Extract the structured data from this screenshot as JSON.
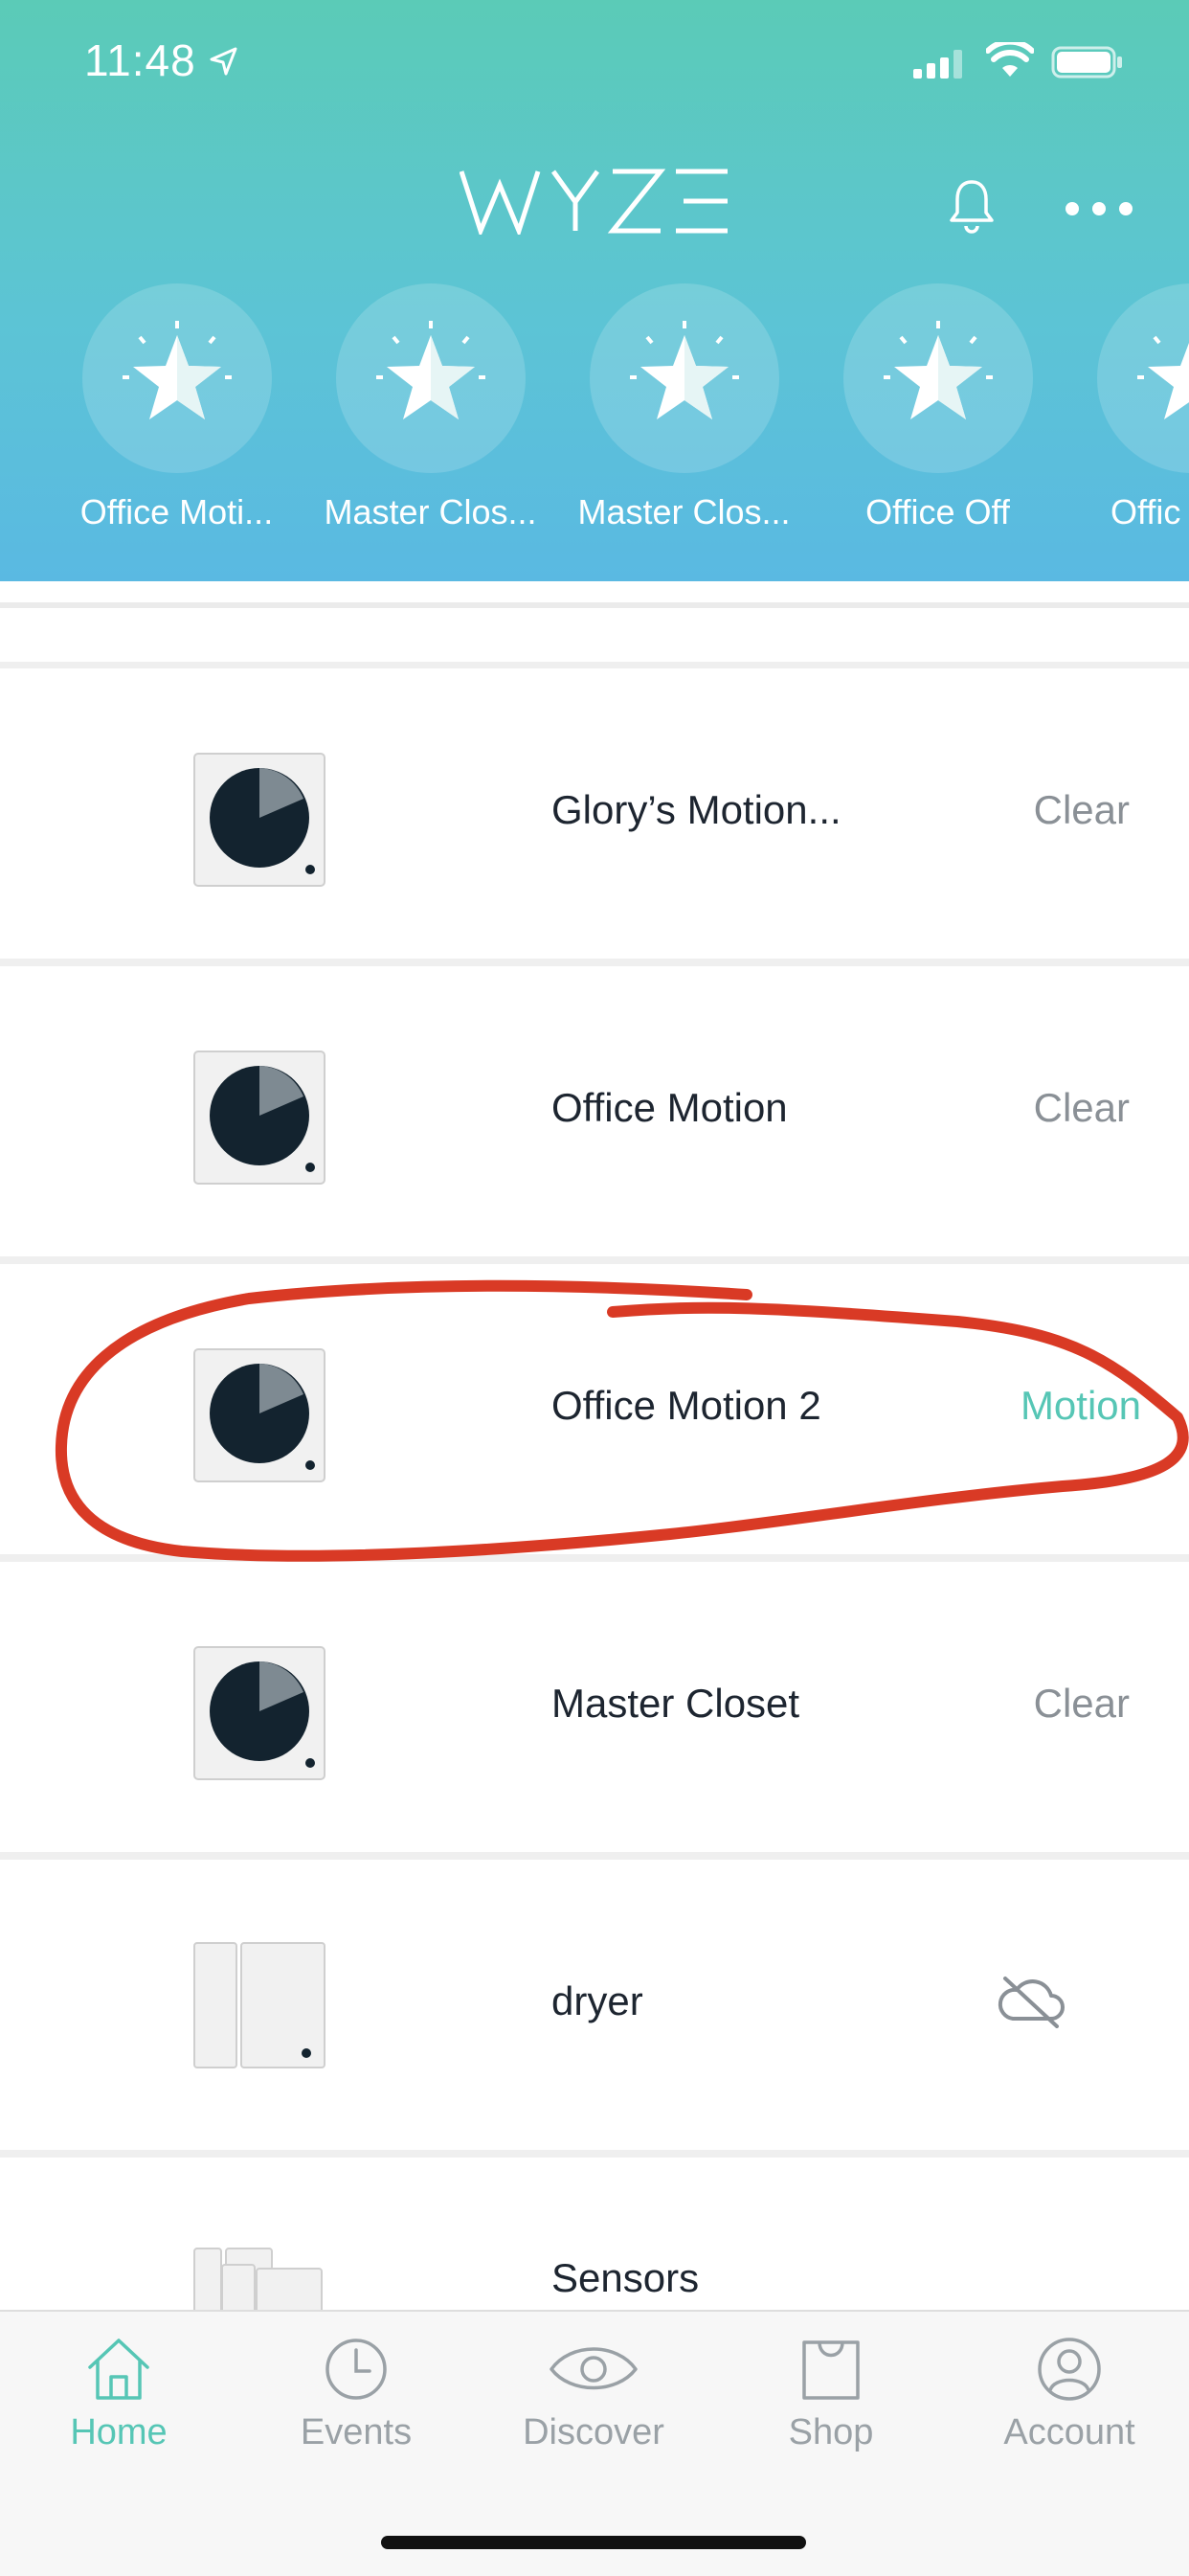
{
  "status_bar": {
    "time": "11:48"
  },
  "header": {
    "logo": "WYZE"
  },
  "favorites": [
    {
      "label": "Office Moti..."
    },
    {
      "label": "Master Clos..."
    },
    {
      "label": "Master Clos..."
    },
    {
      "label": "Office Off"
    },
    {
      "label": "Offic"
    }
  ],
  "devices": [
    {
      "name": "Glory’s Motion...",
      "status": "Clear",
      "icon": "motion-sensor-icon"
    },
    {
      "name": "Office Motion",
      "status": "Clear",
      "icon": "motion-sensor-icon"
    },
    {
      "name": "Office Motion 2",
      "status": "Motion",
      "icon": "motion-sensor-icon"
    },
    {
      "name": "Master Closet",
      "status": "Clear",
      "icon": "motion-sensor-icon"
    },
    {
      "name": "dryer",
      "status": "",
      "icon": "contact-sensor-icon",
      "status_icon": "cloud-offline-icon"
    },
    {
      "name": "Sensors",
      "status": "",
      "icon": "sensor-group-icon"
    }
  ],
  "tabbar": [
    {
      "label": "Home",
      "icon": "home-icon",
      "active": true
    },
    {
      "label": "Events",
      "icon": "clock-icon"
    },
    {
      "label": "Discover",
      "icon": "eye-icon"
    },
    {
      "label": "Shop",
      "icon": "bag-icon"
    },
    {
      "label": "Account",
      "icon": "user-icon"
    }
  ],
  "colors": {
    "accent": "#56c6b5",
    "annotation": "#d93a25",
    "header_top": "#5bcbb7",
    "header_bottom": "#5ab9e2"
  }
}
